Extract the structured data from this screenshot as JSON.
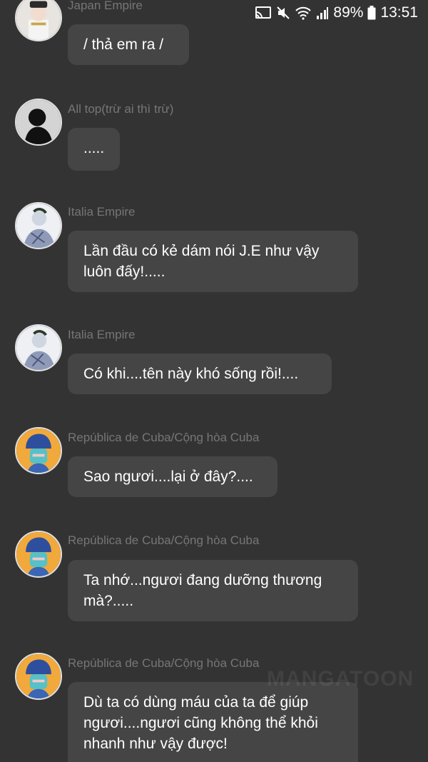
{
  "status_bar": {
    "battery": "89%",
    "time": "13:51",
    "icons": [
      "cast-icon",
      "mute-icon",
      "wifi-icon",
      "signal-icon",
      "battery-icon"
    ]
  },
  "colors": {
    "background": "#333333",
    "bubble": "#454545",
    "sender_text": "#767676",
    "message_text": "#ffffff"
  },
  "messages": [
    {
      "sender": "Japan Empire",
      "text": "/ thả em ra /",
      "avatar": "japan-empire-avatar"
    },
    {
      "sender": "All top(trừ ai thì trừ)",
      "text": ".....",
      "avatar": "silhouette-avatar"
    },
    {
      "sender": "Italia Empire",
      "text": "Lần đầu có kẻ dám nói J.E như vậy luôn đấy!.....",
      "avatar": "italia-empire-avatar"
    },
    {
      "sender": "Italia Empire",
      "text": "Có khi....tên này khó sống rồi!....",
      "avatar": "italia-empire-avatar"
    },
    {
      "sender": "República de Cuba/Cộng hòa Cuba",
      "text": "Sao ngươi....lại ở đây?....",
      "avatar": "cuba-avatar"
    },
    {
      "sender": "República de Cuba/Cộng hòa Cuba",
      "text": "Ta nhớ...ngươi đang dưỡng thương mà?.....",
      "avatar": "cuba-avatar"
    },
    {
      "sender": "República de Cuba/Cộng hòa Cuba",
      "text": "Dù ta có dùng máu của ta để giúp ngươi....ngươi cũng không thể khỏi nhanh như vậy được!",
      "avatar": "cuba-avatar"
    }
  ],
  "watermark": "MANGATOON"
}
